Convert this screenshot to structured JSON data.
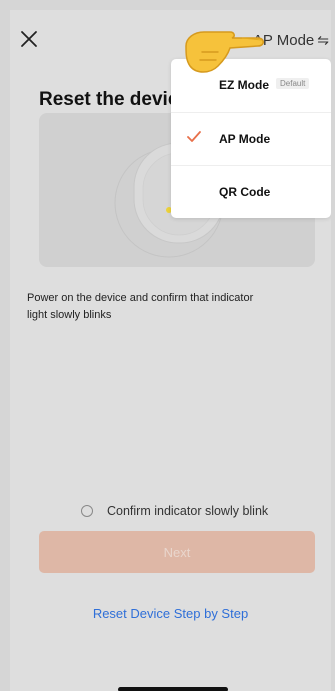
{
  "header": {
    "mode_label": "AP Mode",
    "swap_icon": "⇋"
  },
  "page": {
    "title": "Reset the device",
    "description": "Power on the device and confirm that indicator light slowly blinks",
    "confirm_label": "Confirm indicator slowly blink",
    "next_label": "Next",
    "step_link": "Reset Device Step by Step"
  },
  "menu": {
    "items": [
      {
        "label": "EZ Mode",
        "badge": "Default",
        "selected": false
      },
      {
        "label": "AP Mode",
        "selected": true
      },
      {
        "label": "QR Code",
        "selected": false
      }
    ]
  },
  "colors": {
    "accent_link": "#2f6fd8",
    "next_button": "#deb7a6",
    "check": "#e8704a",
    "indicator_light": "#ecd23a"
  },
  "icons": {
    "close": "close-icon",
    "swap": "swap-arrows-icon",
    "check": "checkmark-icon",
    "pointer": "pointing-hand-emoji"
  }
}
